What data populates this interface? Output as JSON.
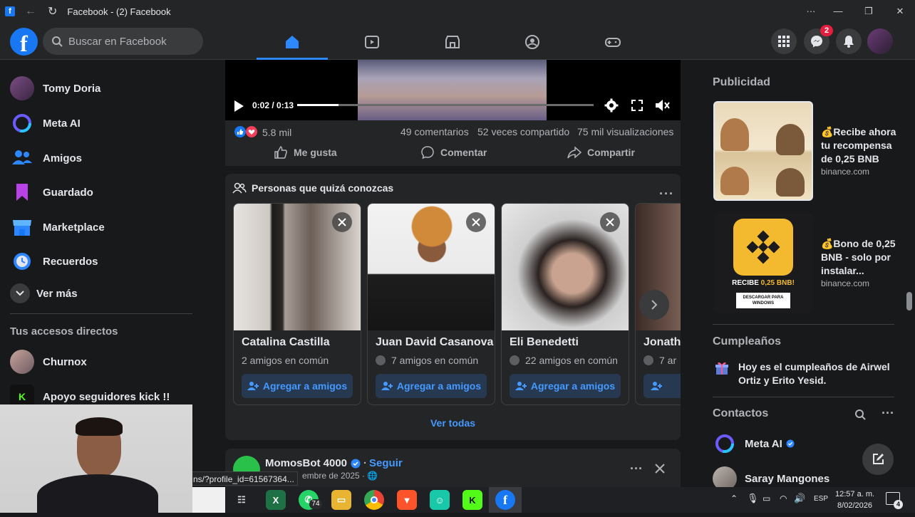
{
  "window": {
    "title": "Facebook - (2) Facebook",
    "controls": [
      "···",
      "—",
      "❐",
      "✕"
    ]
  },
  "header": {
    "search_placeholder": "Buscar en Facebook",
    "messenger_badge": "2",
    "accent": "#1877f2"
  },
  "sidebar": {
    "items": [
      {
        "label": "Tomy Doria",
        "icon": "profile-avatar"
      },
      {
        "label": "Meta AI",
        "icon": "meta-ai-icon"
      },
      {
        "label": "Amigos",
        "icon": "friends-icon"
      },
      {
        "label": "Guardado",
        "icon": "saved-icon"
      },
      {
        "label": "Marketplace",
        "icon": "marketplace-icon"
      },
      {
        "label": "Recuerdos",
        "icon": "memories-icon"
      }
    ],
    "see_more": "Ver más",
    "shortcuts_title": "Tus accesos directos",
    "shortcuts": [
      {
        "label": "Churnox"
      },
      {
        "label": "Apoyo seguidores kick !!"
      }
    ]
  },
  "video_post": {
    "time": "0:02 / 0:13",
    "progress_fraction": 0.14,
    "reactions_count": "5.8 mil",
    "comments": "49 comentarios",
    "shares": "52 veces compartido",
    "views": "75 mil visualizaciones",
    "actions": {
      "like": "Me gusta",
      "comment": "Comentar",
      "share": "Compartir"
    }
  },
  "pymk": {
    "title": "Personas que quizá conozcas",
    "add_label": "Agregar a amigos",
    "see_all": "Ver todas",
    "people": [
      {
        "name": "Catalina Castilla",
        "mutual": "2 amigos en común",
        "photo_color": "#6b5f58"
      },
      {
        "name": "Juan David Casanova",
        "mutual": "7 amigos en común",
        "photo_color": "#c9a36a"
      },
      {
        "name": "Eli Benedetti",
        "mutual": "22 amigos en común",
        "photo_color": "#9a8e88"
      },
      {
        "name": "Jonatha",
        "mutual": "7 ar",
        "photo_color": "#5b4a44"
      }
    ]
  },
  "next_post": {
    "author": "MomosBot 4000",
    "follow": "Seguir",
    "date_fragment": "embre de 2025 ·",
    "url_tooltip": "ns/?profile_id=61567364..."
  },
  "right": {
    "ads_title": "Publicidad",
    "ads": [
      {
        "text": "💰Recibe ahora tu recompensa de 0,25 BNB",
        "domain": "binance.com"
      },
      {
        "text": "💰Bono de 0,25 BNB - solo por instalar...",
        "domain": "binance.com",
        "img_caption": "RECIBE 0,25 BNB!",
        "img_button": "DESCARGAR PARA WINDOWS"
      }
    ],
    "birthdays_title": "Cumpleaños",
    "birthday_text": "Hoy es el cumpleaños de Airwel Ortiz y Erito Yesid.",
    "contacts_title": "Contactos",
    "contacts": [
      {
        "name": "Meta AI"
      },
      {
        "name": "Saray Mangones"
      }
    ]
  },
  "taskbar": {
    "whatsapp_badge": "74",
    "lang": "ESP",
    "time": "12:57 a. m.",
    "date": "8/02/2026",
    "notif_count": "4"
  }
}
